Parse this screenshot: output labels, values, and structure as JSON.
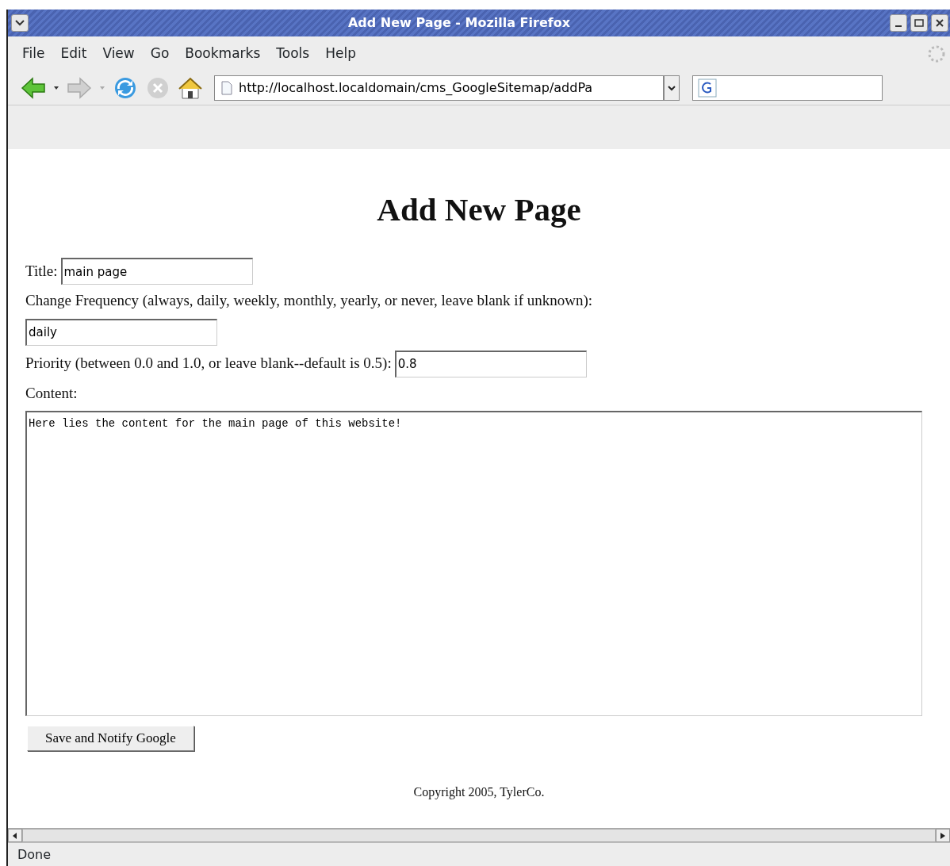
{
  "window": {
    "title": "Add New Page - Mozilla Firefox"
  },
  "menu": [
    "File",
    "Edit",
    "View",
    "Go",
    "Bookmarks",
    "Tools",
    "Help"
  ],
  "toolbar": [
    {
      "kind": "back",
      "disabled": false
    },
    {
      "kind": "forward",
      "disabled": true
    },
    {
      "kind": "reload",
      "disabled": false
    },
    {
      "kind": "stop",
      "disabled": true
    },
    {
      "kind": "home",
      "disabled": false
    }
  ],
  "address": {
    "value": "http://localhost.localdomain/cms_GoogleSitemap/addPa"
  },
  "page": {
    "heading": "Add New Page",
    "fields": [
      {
        "kind": "inline",
        "label": "Title:",
        "value": "main page"
      },
      {
        "kind": "below",
        "label": "Change Frequency (always, daily, weekly, monthly, yearly, or never, leave blank if unknown):",
        "value": "daily"
      },
      {
        "kind": "inline",
        "label": "Priority (between 0.0 and 1.0, or leave blank--default is 0.5):",
        "value": "0.8"
      },
      {
        "kind": "textarea",
        "label": "Content:",
        "value": "Here lies the content for the main page of this website!"
      }
    ],
    "button": "Save and Notify Google",
    "footer": "Copyright 2005, TylerCo."
  },
  "status_bar": "Done"
}
